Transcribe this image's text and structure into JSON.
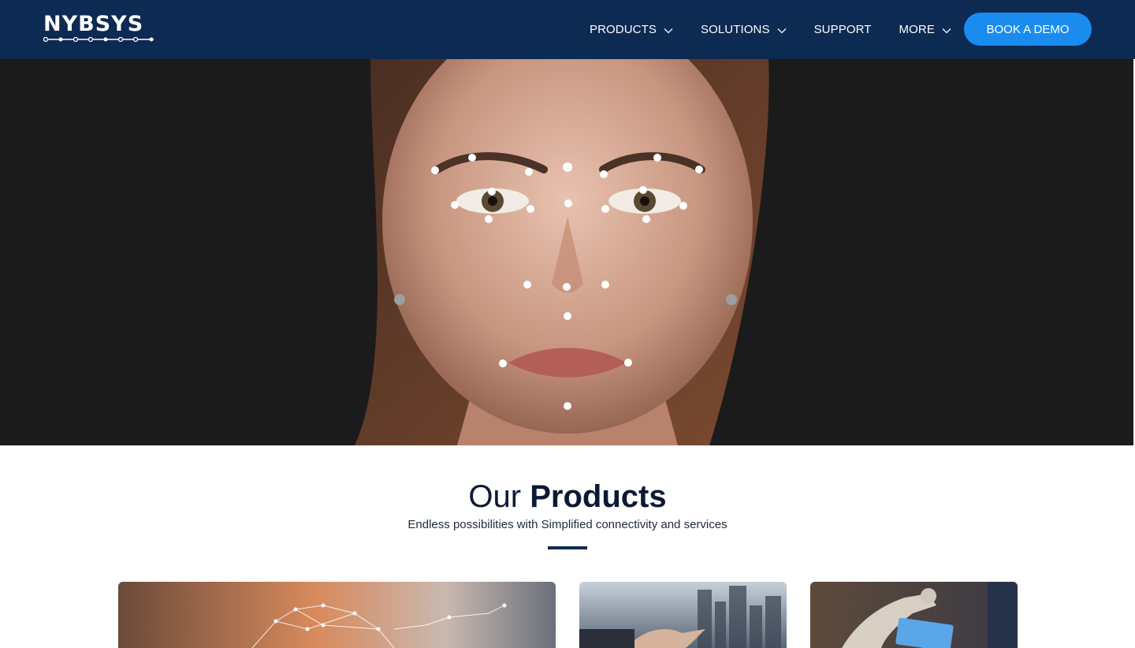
{
  "brand": {
    "logo_text": "NYBSYS",
    "colors": {
      "header_bg": "#0d2a52",
      "accent": "#1a8cf0",
      "rule": "#0d2a52"
    }
  },
  "nav": {
    "items": [
      {
        "label": "PRODUCTS",
        "has_dropdown": true,
        "icon": "chevron-down-icon"
      },
      {
        "label": "SOLUTIONS",
        "has_dropdown": true,
        "icon": "chevron-down-icon"
      },
      {
        "label": "SUPPORT",
        "has_dropdown": false
      },
      {
        "label": "MORE",
        "has_dropdown": true,
        "icon": "chevron-down-icon"
      }
    ],
    "cta_label": "BOOK A DEMO"
  },
  "products": {
    "title_light": "Our",
    "title_bold": "Products",
    "subtitle": "Endless possibilities with Simplified connectivity and services"
  }
}
